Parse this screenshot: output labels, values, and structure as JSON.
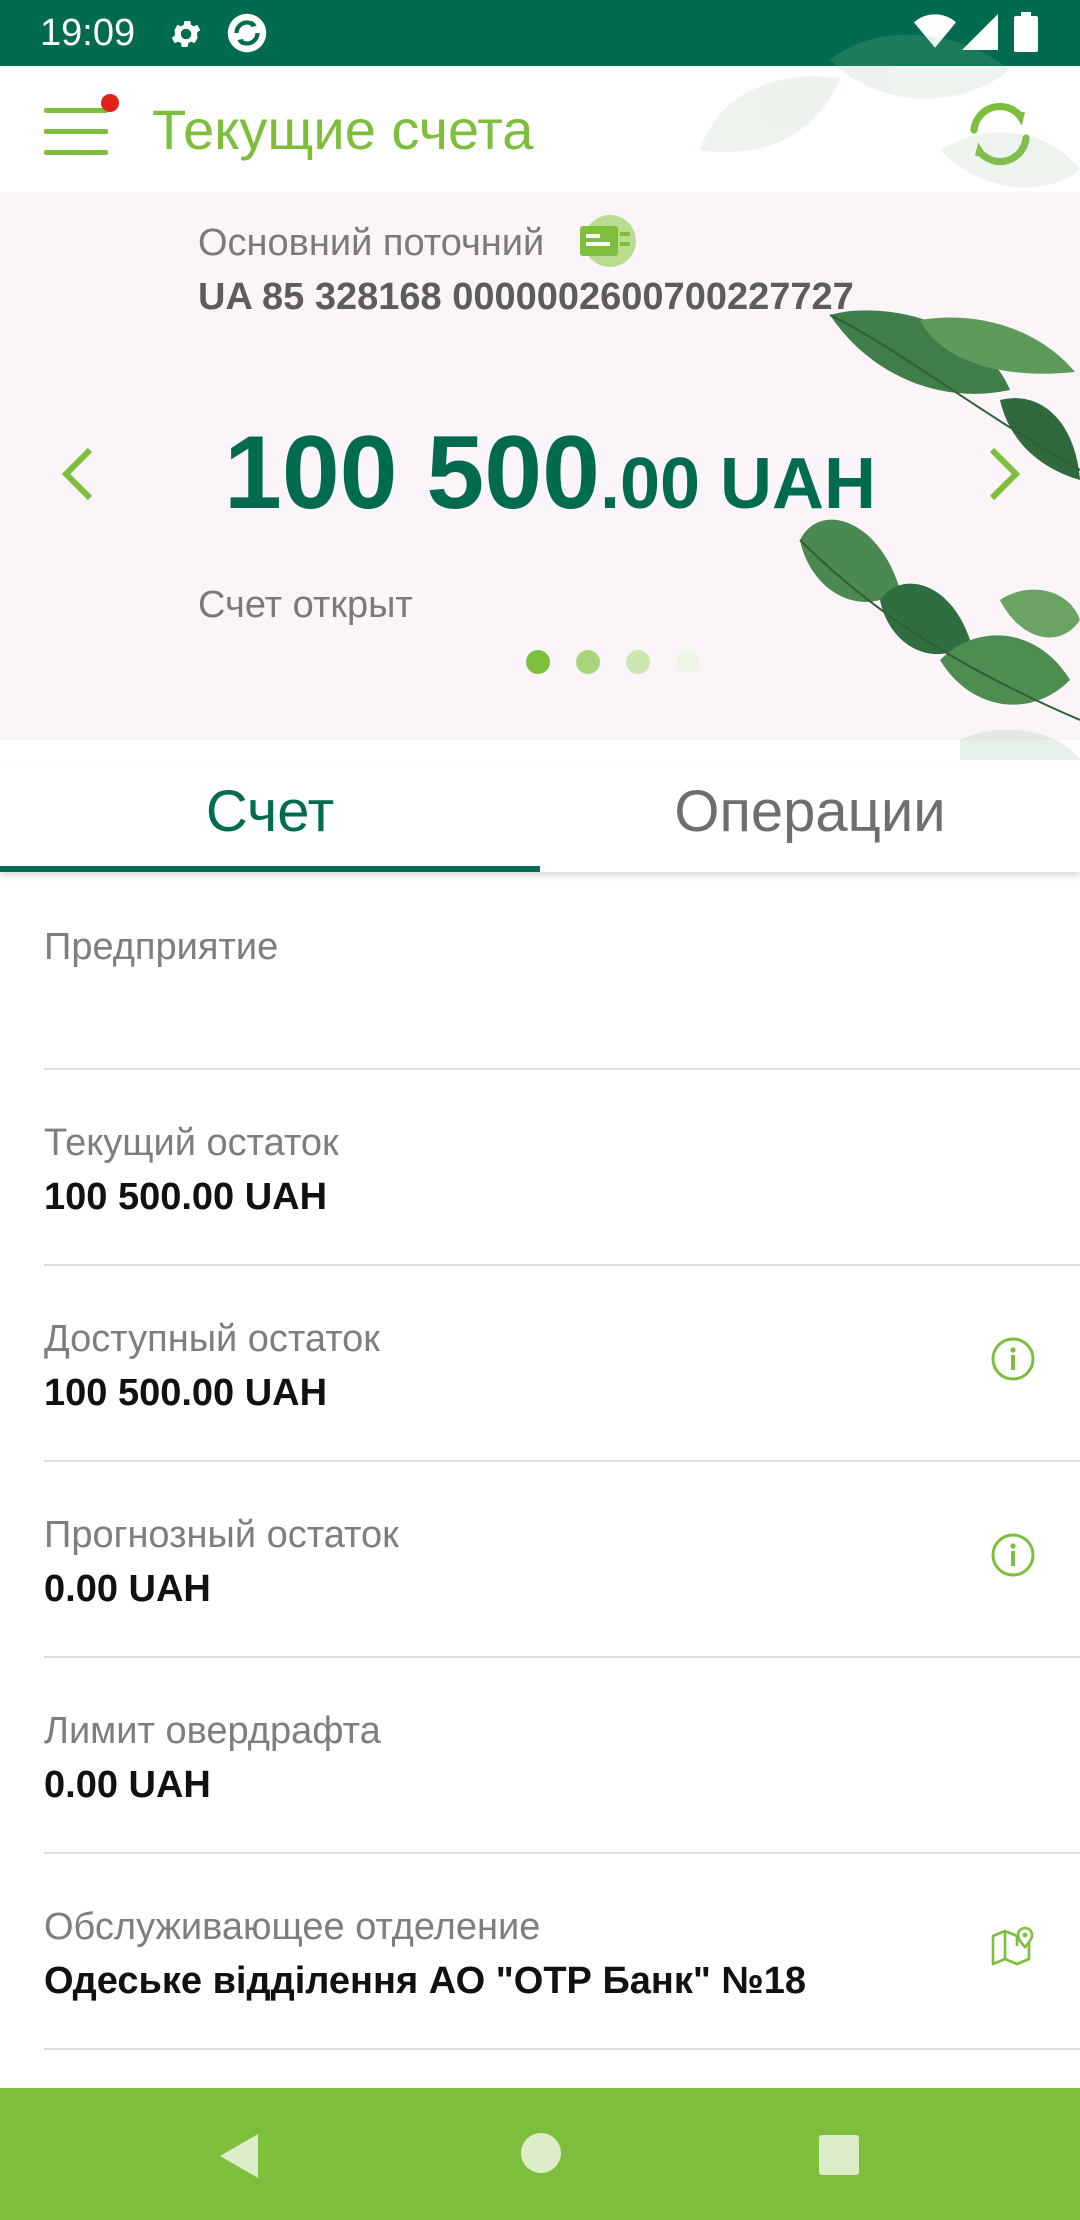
{
  "status_bar": {
    "time": "19:09",
    "icons": [
      "settings-gear-icon",
      "sync-app-icon",
      "wifi-icon",
      "cell-signal-icon",
      "battery-icon"
    ]
  },
  "app_bar": {
    "title": "Текущие счета",
    "has_notification": true,
    "icons": [
      "hamburger-menu-icon",
      "refresh-icon"
    ]
  },
  "account_card": {
    "name": "Основний поточний",
    "iban": "UA 85 328168 0000002600700227727",
    "balance_int": "100 500",
    "balance_dec": ".00 UAH",
    "status": "Счет открыт",
    "page_count": 4,
    "current_page": 1
  },
  "tabs": {
    "account": "Счет",
    "operations": "Операции",
    "active": "account"
  },
  "details": [
    {
      "label": "Предприятие",
      "value": "",
      "icon": ""
    },
    {
      "label": "Текущий остаток",
      "value": "100 500.00 UAH",
      "icon": ""
    },
    {
      "label": "Доступный остаток",
      "value": "100 500.00 UAH",
      "icon": "info-icon"
    },
    {
      "label": "Прогнозный остаток",
      "value": "0.00 UAH",
      "icon": "info-icon"
    },
    {
      "label": "Лимит овердрафта",
      "value": "0.00 UAH",
      "icon": ""
    },
    {
      "label": "Обслуживающее отделение",
      "value": "Одеське відділення АО \"ОТР Банк\" №18",
      "icon": "map-pin-icon"
    }
  ],
  "colors": {
    "primary_dark_green": "#016B4F",
    "accent_green": "#7DBE3C",
    "notification_red": "#E0201A",
    "card_background": "#FBF5F9"
  }
}
